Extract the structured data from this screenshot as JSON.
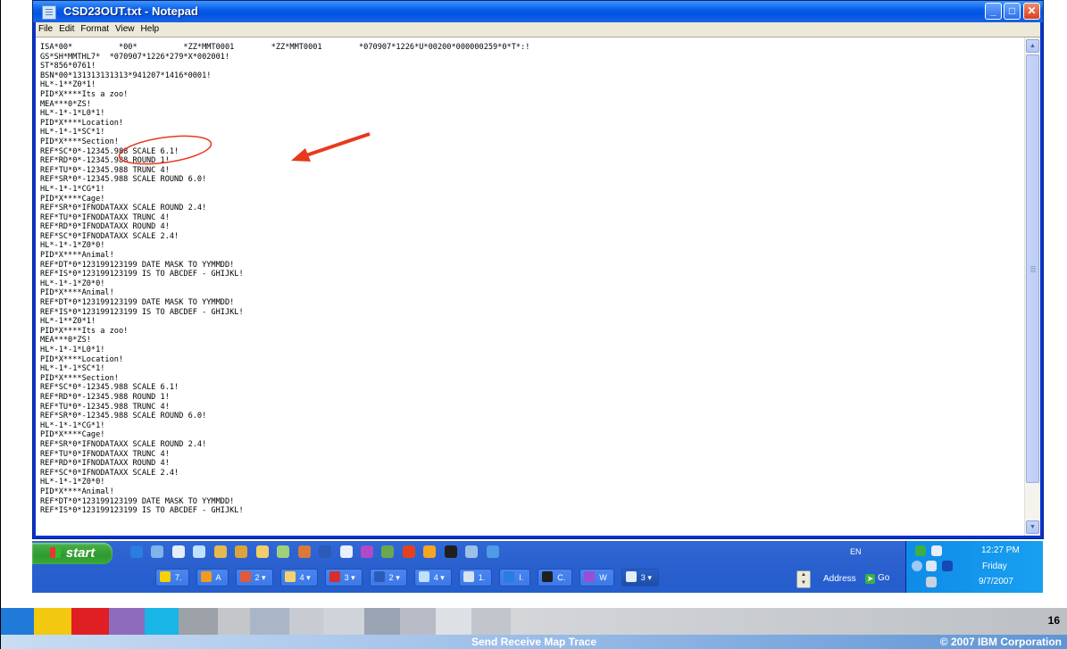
{
  "window": {
    "title": "CSD23OUT.txt - Notepad",
    "menu": [
      "File",
      "Edit",
      "Format",
      "View",
      "Help"
    ]
  },
  "editor": {
    "lines": [
      "ISA*00*          *00*          *ZZ*MMT0001        *ZZ*MMT0001        *070907*1226*U*00200*000000259*0*T*:!",
      "GS*SH*MMTHL7*  *070907*1226*279*X*002001!",
      "ST*856*0761!",
      "BSN*00*131313131313*941207*1416*0001!",
      "HL*-1**Z0*1!",
      "PID*X****Its a zoo!",
      "MEA***0*ZS!",
      "HL*-1*-1*L0*1!",
      "PID*X****Location!",
      "HL*-1*-1*SC*1!",
      "PID*X****Section!",
      "REF*SC*0*-12345.988 SCALE 6.1!",
      "REF*RD*0*-12345.988 ROUND 1!",
      "REF*TU*0*-12345.988 TRUNC 4!",
      "REF*SR*0*-12345.988 SCALE ROUND 6.0!",
      "HL*-1*-1*CG*1!",
      "PID*X****Cage!",
      "REF*SR*0*IFNODATAXX SCALE ROUND 2.4!",
      "REF*TU*0*IFNODATAXX TRUNC 4!",
      "REF*RD*0*IFNODATAXX ROUND 4!",
      "REF*SC*0*IFNODATAXX SCALE 2.4!",
      "HL*-1*-1*Z0*0!",
      "PID*X****Animal!",
      "REF*DT*0*123199123199 DATE MASK TO YYMMDD!",
      "REF*IS*0*123199123199 IS TO ABCDEF - GHIJKL!",
      "HL*-1*-1*Z0*0!",
      "PID*X****Animal!",
      "REF*DT*0*123199123199 DATE MASK TO YYMMDD!",
      "REF*IS*0*123199123199 IS TO ABCDEF - GHIJKL!",
      "HL*-1**Z0*1!",
      "PID*X****Its a zoo!",
      "MEA***0*ZS!",
      "HL*-1*-1*L0*1!",
      "PID*X****Location!",
      "HL*-1*-1*SC*1!",
      "PID*X****Section!",
      "REF*SC*0*-12345.988 SCALE 6.1!",
      "REF*RD*0*-12345.988 ROUND 1!",
      "REF*TU*0*-12345.988 TRUNC 4!",
      "REF*SR*0*-12345.988 SCALE ROUND 6.0!",
      "HL*-1*-1*CG*1!",
      "PID*X****Cage!",
      "REF*SR*0*IFNODATAXX SCALE ROUND 2.4!",
      "REF*TU*0*IFNODATAXX TRUNC 4!",
      "REF*RD*0*IFNODATAXX ROUND 4!",
      "REF*SC*0*IFNODATAXX SCALE 2.4!",
      "HL*-1*-1*Z0*0!",
      "PID*X****Animal!",
      "REF*DT*0*123199123199 DATE MASK TO YYMMDD!",
      "REF*IS*0*123199123199 IS TO ABCDEF - GHIJKL!"
    ]
  },
  "taskbar": {
    "start_label": "start",
    "tasks": [
      "7.",
      "A",
      "2",
      "4",
      "3",
      "2",
      "4",
      "1.",
      "I.",
      "C.",
      "W",
      "3"
    ],
    "language": "EN",
    "address_label": "Address",
    "go_label": "Go",
    "clock_time": "12:27 PM",
    "clock_day": "Friday",
    "clock_date": "9/7/2007"
  },
  "footer": {
    "title": "Send Receive Map Trace",
    "copyright": "© 2007 IBM Corporation",
    "page_number": "16"
  },
  "colors": {
    "annotation": "#e8391d",
    "title_bar": "#0054e3",
    "taskbar": "#245ecd",
    "start_button": "#3aa83a"
  }
}
